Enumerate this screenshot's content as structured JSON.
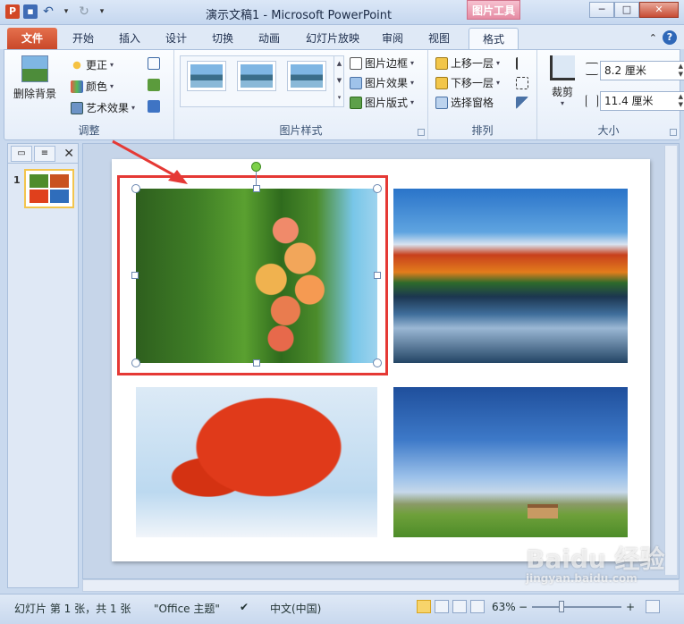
{
  "window": {
    "title": "演示文稿1 - Microsoft PowerPoint",
    "contextual_tab": "图片工具"
  },
  "tabs": [
    {
      "label": "文件"
    },
    {
      "label": "开始"
    },
    {
      "label": "插入"
    },
    {
      "label": "设计"
    },
    {
      "label": "切换"
    },
    {
      "label": "动画"
    },
    {
      "label": "幻灯片放映"
    },
    {
      "label": "审阅"
    },
    {
      "label": "视图"
    },
    {
      "label": "格式"
    }
  ],
  "ribbon": {
    "adjust": {
      "remove_bg": "删除背景",
      "corrections": "更正",
      "color": "颜色",
      "artistic": "艺术效果",
      "label": "调整"
    },
    "styles": {
      "border": "图片边框",
      "effects": "图片效果",
      "layout": "图片版式",
      "label": "图片样式"
    },
    "arrange": {
      "bring_forward": "上移一层",
      "send_backward": "下移一层",
      "selection_pane": "选择窗格",
      "label": "排列"
    },
    "size": {
      "crop": "裁剪",
      "height": "8.2 厘米",
      "width": "11.4 厘米",
      "label": "大小"
    }
  },
  "slide_pane": {
    "slide_number": "1"
  },
  "status": {
    "slide_info": "幻灯片 第 1 张，共 1 张",
    "theme": "\"Office 主题\"",
    "language": "中文(中国)",
    "zoom": "63%"
  },
  "watermark": {
    "brand": "Baidu 经验",
    "url": "jingyan.baidu.com"
  }
}
